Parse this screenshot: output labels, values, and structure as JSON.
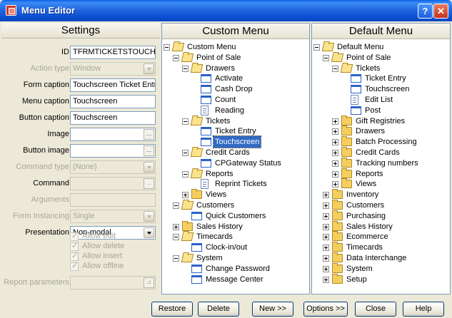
{
  "window": {
    "title": "Menu Editor",
    "help_label": "?",
    "close_label": "✕"
  },
  "settings": {
    "header": "Settings",
    "fields": [
      {
        "label": "ID",
        "value": "TFRMTICKETSTOUCHSC",
        "disabled": false,
        "control": "text"
      },
      {
        "label": "Action type",
        "value": "Window",
        "disabled": true,
        "control": "dropdown"
      },
      {
        "label": "Form caption",
        "value": "Touchscreen Ticket Entry",
        "disabled": false,
        "control": "text"
      },
      {
        "label": "Menu caption",
        "value": "Touchscreen",
        "disabled": false,
        "control": "text"
      },
      {
        "label": "Button caption",
        "value": "Touchscreen",
        "disabled": false,
        "control": "text"
      },
      {
        "label": "Image",
        "value": "",
        "disabled": false,
        "control": "browse"
      },
      {
        "label": "Button image",
        "value": "",
        "disabled": false,
        "control": "browse"
      },
      {
        "label": "Command type",
        "value": "(None)",
        "disabled": true,
        "control": "dropdown"
      },
      {
        "label": "Command",
        "value": "",
        "disabled": false,
        "control": "browse"
      },
      {
        "label": "Arguments",
        "value": "",
        "disabled": true,
        "control": "text"
      },
      {
        "label": "Form Instancing",
        "value": "Single",
        "disabled": true,
        "control": "dropdown"
      },
      {
        "label": "Presentation",
        "value": "Non-modal",
        "disabled": false,
        "control": "dropdown"
      }
    ],
    "checkboxes": [
      "Allow edit",
      "Allow delete",
      "Allow insert",
      "Allow offline"
    ],
    "report_parameters": {
      "label": "Report parameters",
      "value": ""
    }
  },
  "custom_menu": {
    "header": "Custom Menu",
    "nodes": [
      {
        "label": "Custom Menu",
        "level": 0,
        "type": "folder-open",
        "expander": "minus"
      },
      {
        "label": "Point of Sale",
        "level": 1,
        "type": "folder-open",
        "expander": "minus"
      },
      {
        "label": "Drawers",
        "level": 2,
        "type": "folder-open",
        "expander": "minus"
      },
      {
        "label": "Activate",
        "level": 3,
        "type": "window",
        "expander": ""
      },
      {
        "label": "Cash Drop",
        "level": 3,
        "type": "window",
        "expander": ""
      },
      {
        "label": "Count",
        "level": 3,
        "type": "window",
        "expander": ""
      },
      {
        "label": "Reading",
        "level": 3,
        "type": "doc",
        "expander": ""
      },
      {
        "label": "Tickets",
        "level": 2,
        "type": "folder-open",
        "expander": "minus"
      },
      {
        "label": "Ticket Entry",
        "level": 3,
        "type": "window",
        "expander": ""
      },
      {
        "label": "Touchscreen",
        "level": 3,
        "type": "window",
        "expander": "",
        "selected": true
      },
      {
        "label": "Credit Cards",
        "level": 2,
        "type": "folder-open",
        "expander": "minus"
      },
      {
        "label": "CPGateway Status",
        "level": 3,
        "type": "window",
        "expander": ""
      },
      {
        "label": "Reports",
        "level": 2,
        "type": "folder-open",
        "expander": "minus"
      },
      {
        "label": "Reprint Tickets",
        "level": 3,
        "type": "doc",
        "expander": ""
      },
      {
        "label": "Views",
        "level": 2,
        "type": "folder",
        "expander": "plus"
      },
      {
        "label": "Customers",
        "level": 1,
        "type": "folder-open",
        "expander": "minus"
      },
      {
        "label": "Quick Customers",
        "level": 2,
        "type": "window",
        "expander": ""
      },
      {
        "label": "Sales History",
        "level": 1,
        "type": "folder",
        "expander": "plus"
      },
      {
        "label": "Timecards",
        "level": 1,
        "type": "folder-open",
        "expander": "minus"
      },
      {
        "label": "Clock-in/out",
        "level": 2,
        "type": "window",
        "expander": ""
      },
      {
        "label": "System",
        "level": 1,
        "type": "folder-open",
        "expander": "minus"
      },
      {
        "label": "Change Password",
        "level": 2,
        "type": "window",
        "expander": ""
      },
      {
        "label": "Message Center",
        "level": 2,
        "type": "window",
        "expander": ""
      }
    ]
  },
  "default_menu": {
    "header": "Default Menu",
    "nodes": [
      {
        "label": "Default Menu",
        "level": 0,
        "type": "folder-open",
        "expander": "minus"
      },
      {
        "label": "Point of Sale",
        "level": 1,
        "type": "folder-open",
        "expander": "minus"
      },
      {
        "label": "Tickets",
        "level": 2,
        "type": "folder-open",
        "expander": "minus"
      },
      {
        "label": "Ticket Entry",
        "level": 3,
        "type": "window",
        "expander": ""
      },
      {
        "label": "Touchscreen",
        "level": 3,
        "type": "window",
        "expander": ""
      },
      {
        "label": "Edit List",
        "level": 3,
        "type": "doc",
        "expander": ""
      },
      {
        "label": "Post",
        "level": 3,
        "type": "window",
        "expander": ""
      },
      {
        "label": "Gift Registries",
        "level": 2,
        "type": "folder",
        "expander": "plus"
      },
      {
        "label": "Drawers",
        "level": 2,
        "type": "folder",
        "expander": "plus"
      },
      {
        "label": "Batch Processing",
        "level": 2,
        "type": "folder",
        "expander": "plus"
      },
      {
        "label": "Credit Cards",
        "level": 2,
        "type": "folder",
        "expander": "plus"
      },
      {
        "label": "Tracking numbers",
        "level": 2,
        "type": "folder",
        "expander": "plus"
      },
      {
        "label": "Reports",
        "level": 2,
        "type": "folder",
        "expander": "plus"
      },
      {
        "label": "Views",
        "level": 2,
        "type": "folder",
        "expander": "plus"
      },
      {
        "label": "Inventory",
        "level": 1,
        "type": "folder",
        "expander": "plus"
      },
      {
        "label": "Customers",
        "level": 1,
        "type": "folder",
        "expander": "plus"
      },
      {
        "label": "Purchasing",
        "level": 1,
        "type": "folder",
        "expander": "plus"
      },
      {
        "label": "Sales History",
        "level": 1,
        "type": "folder",
        "expander": "plus"
      },
      {
        "label": "Ecommerce",
        "level": 1,
        "type": "folder",
        "expander": "plus"
      },
      {
        "label": "Timecards",
        "level": 1,
        "type": "folder",
        "expander": "plus"
      },
      {
        "label": "Data Interchange",
        "level": 1,
        "type": "folder",
        "expander": "plus"
      },
      {
        "label": "System",
        "level": 1,
        "type": "folder",
        "expander": "plus"
      },
      {
        "label": "Setup",
        "level": 1,
        "type": "folder",
        "expander": "plus"
      }
    ]
  },
  "buttons": [
    {
      "label": "Restore",
      "name": "restore-button"
    },
    {
      "label": "Delete",
      "name": "delete-button"
    },
    {
      "label": "New >>",
      "name": "new-button"
    },
    {
      "label": "Options >>",
      "name": "options-button"
    },
    {
      "label": "Close",
      "name": "close-dialog-button"
    },
    {
      "label": "Help",
      "name": "help-dialog-button"
    }
  ]
}
